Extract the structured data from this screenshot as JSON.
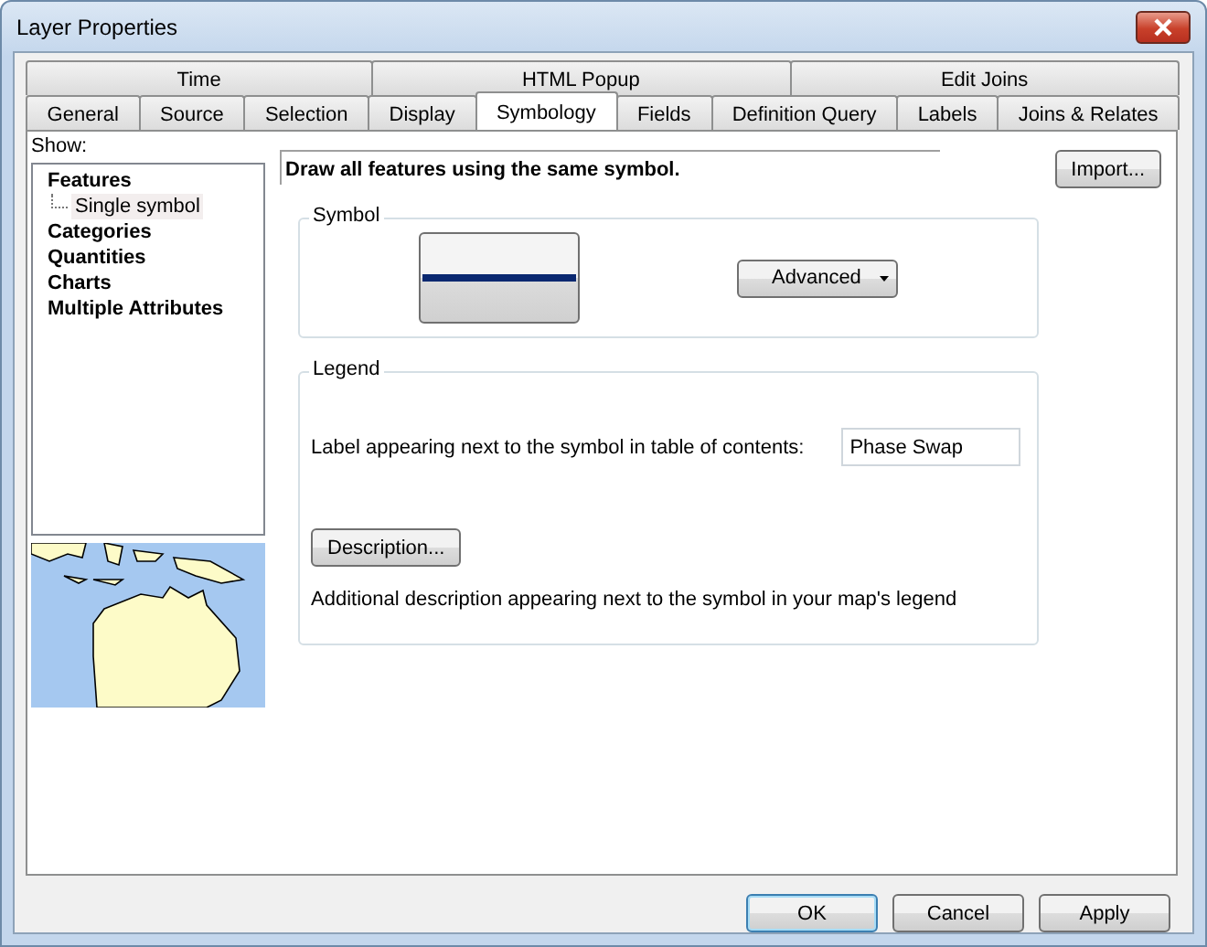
{
  "window": {
    "title": "Layer Properties"
  },
  "tab_rows": [
    [
      {
        "label": "Time",
        "selected": false
      },
      {
        "label": "HTML Popup",
        "selected": false
      },
      {
        "label": "Edit Joins",
        "selected": false
      }
    ],
    [
      {
        "label": "General",
        "selected": false
      },
      {
        "label": "Source",
        "selected": false
      },
      {
        "label": "Selection",
        "selected": false
      },
      {
        "label": "Display",
        "selected": false
      },
      {
        "label": "Symbology",
        "selected": true
      },
      {
        "label": "Fields",
        "selected": false
      },
      {
        "label": "Definition Query",
        "selected": false
      },
      {
        "label": "Labels",
        "selected": false
      },
      {
        "label": "Joins & Relates",
        "selected": false
      }
    ]
  ],
  "show": {
    "label": "Show:",
    "tree": [
      {
        "label": "Features",
        "selected": false,
        "children": [
          {
            "label": "Single symbol",
            "selected": true
          }
        ]
      },
      {
        "label": "Categories",
        "selected": false
      },
      {
        "label": "Quantities",
        "selected": false
      },
      {
        "label": "Charts",
        "selected": false
      },
      {
        "label": "Multiple Attributes",
        "selected": false
      }
    ]
  },
  "heading": "Draw all features using the same symbol.",
  "import_button": "Import...",
  "symbol_group": {
    "title": "Symbol",
    "advanced_button": "Advanced"
  },
  "legend_group": {
    "title": "Legend",
    "label_prompt": "Label appearing next to the symbol in table of contents:",
    "label_value": "Phase Swap",
    "description_button": "Description...",
    "description_note": "Additional description appearing next to the symbol in your map's legend"
  },
  "buttons": [
    {
      "label": "OK",
      "default": true
    },
    {
      "label": "Cancel",
      "default": false
    },
    {
      "label": "Apply",
      "default": false
    }
  ]
}
